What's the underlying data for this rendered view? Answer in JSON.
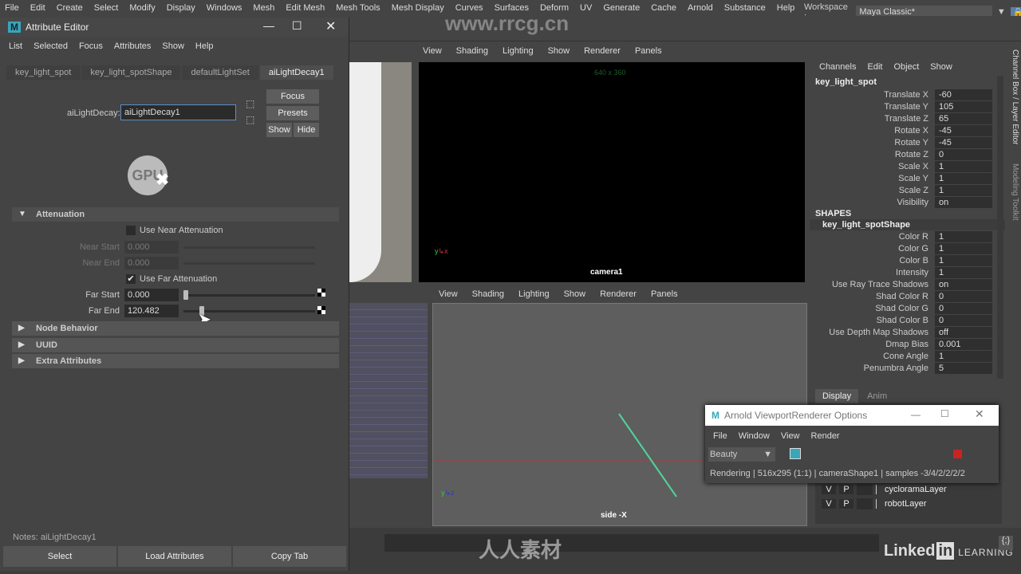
{
  "menubar": [
    "File",
    "Edit",
    "Create",
    "Select",
    "Modify",
    "Display",
    "Windows",
    "Mesh",
    "Edit Mesh",
    "Mesh Tools",
    "Mesh Display",
    "Curves",
    "Surfaces",
    "Deform",
    "UV",
    "Generate",
    "Cache",
    "Arnold",
    "Substance",
    "Help"
  ],
  "workspace": {
    "label": "Workspace :",
    "value": "Maya Classic*"
  },
  "watermark": "www.rrcg.cn",
  "viewport_top": {
    "menu": [
      "View",
      "Shading",
      "Lighting",
      "Show",
      "Renderer",
      "Panels"
    ],
    "resolution": "640 x 360",
    "camera": "camera1"
  },
  "viewport_bottom": {
    "menu": [
      "View",
      "Shading",
      "Lighting",
      "Show",
      "Renderer",
      "Panels"
    ],
    "camera": "side -X"
  },
  "attribute_editor": {
    "title": "Attribute Editor",
    "menu": [
      "List",
      "Selected",
      "Focus",
      "Attributes",
      "Show",
      "Help"
    ],
    "tabs": [
      "key_light_spot",
      "key_light_spotShape",
      "defaultLightSet",
      "aiLightDecay1"
    ],
    "active_tab": 3,
    "node_label": "aiLightDecay:",
    "node_value": "aiLightDecay1",
    "buttons": {
      "focus": "Focus",
      "presets": "Presets",
      "show": "Show",
      "hide": "Hide"
    },
    "gpu_label": "GPU",
    "attenuation": {
      "title": "Attenuation",
      "use_near": "Use Near Attenuation",
      "use_near_checked": false,
      "near_start_label": "Near Start",
      "near_start": "0.000",
      "near_end_label": "Near End",
      "near_end": "0.000",
      "use_far": "Use Far Attenuation",
      "use_far_checked": true,
      "far_start_label": "Far Start",
      "far_start": "0.000",
      "far_end_label": "Far End",
      "far_end": "120.482"
    },
    "sections": [
      "Node Behavior",
      "UUID",
      "Extra Attributes"
    ],
    "notes": "Notes: aiLightDecay1",
    "footer": [
      "Select",
      "Load Attributes",
      "Copy Tab"
    ]
  },
  "channel_box": {
    "menu": [
      "Channels",
      "Edit",
      "Object",
      "Show"
    ],
    "node": "key_light_spot",
    "attrs": [
      [
        "Translate X",
        "-60"
      ],
      [
        "Translate Y",
        "105"
      ],
      [
        "Translate Z",
        "65"
      ],
      [
        "Rotate X",
        "-45"
      ],
      [
        "Rotate Y",
        "-45"
      ],
      [
        "Rotate Z",
        "0"
      ],
      [
        "Scale X",
        "1"
      ],
      [
        "Scale Y",
        "1"
      ],
      [
        "Scale Z",
        "1"
      ],
      [
        "Visibility",
        "on"
      ]
    ],
    "shapes_label": "SHAPES",
    "shape": "key_light_spotShape",
    "shape_attrs": [
      [
        "Color R",
        "1"
      ],
      [
        "Color G",
        "1"
      ],
      [
        "Color B",
        "1"
      ],
      [
        "Intensity",
        "1"
      ],
      [
        "Use Ray Trace Shadows",
        "on"
      ],
      [
        "Shad Color R",
        "0"
      ],
      [
        "Shad Color G",
        "0"
      ],
      [
        "Shad Color B",
        "0"
      ],
      [
        "Use Depth Map Shadows",
        "off"
      ],
      [
        "Dmap Bias",
        "0.001"
      ],
      [
        "Cone Angle",
        "1"
      ],
      [
        "Penumbra Angle",
        "5"
      ]
    ],
    "side_tabs": [
      "Channel Box / Layer Editor",
      "Modeling Toolkit"
    ],
    "layer_tabs": [
      "Display",
      "Anim"
    ],
    "layers": [
      {
        "v": "V",
        "p": "P",
        "name": "cycloramaLayer"
      },
      {
        "v": "V",
        "p": "P",
        "name": "robotLayer"
      }
    ]
  },
  "arnold": {
    "title": "Arnold ViewportRenderer Options",
    "menu": [
      "File",
      "Window",
      "View",
      "Render"
    ],
    "aov": "Beauty",
    "status": "Rendering | 516x295 (1:1) | cameraShape1  | samples -3/4/2/2/2/2",
    "stop_color": "#cc2222"
  },
  "branding": {
    "linkedin": "Linked",
    "in": "in",
    "learning": "LEARNING",
    "bottom_watermark": "人人素材"
  }
}
